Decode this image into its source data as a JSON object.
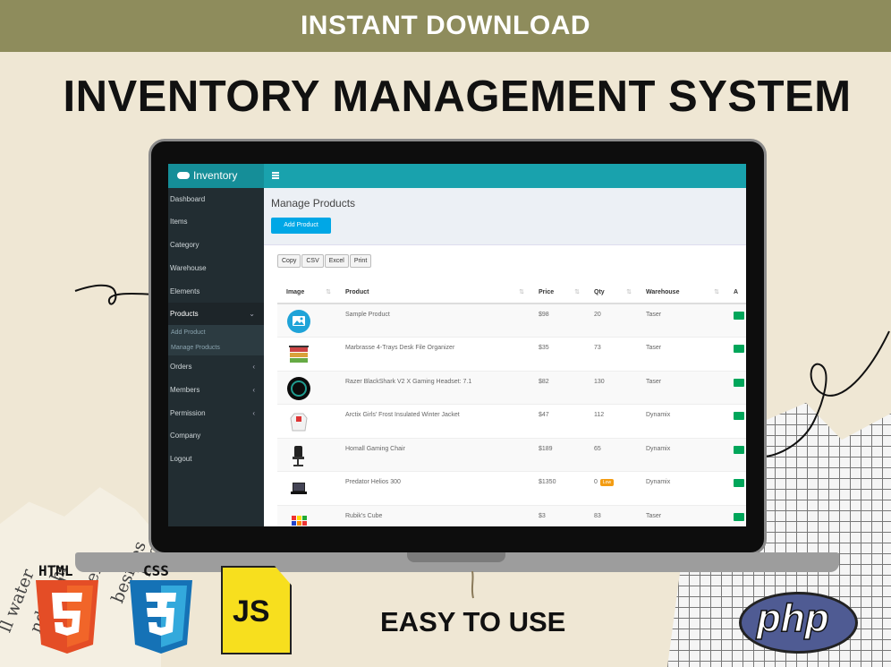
{
  "banner": {
    "text": "INSTANT DOWNLOAD"
  },
  "headline": {
    "text": "INVENTORY MANAGEMENT SYSTEM"
  },
  "app": {
    "brand": "Inventory",
    "sidebar": {
      "items": [
        {
          "label": "Dashboard"
        },
        {
          "label": "Items"
        },
        {
          "label": "Category"
        },
        {
          "label": "Warehouse"
        },
        {
          "label": "Elements"
        },
        {
          "label": "Products",
          "chevron": "⌄"
        },
        {
          "label": "Orders",
          "chevron": "‹"
        },
        {
          "label": "Members",
          "chevron": "‹"
        },
        {
          "label": "Permission",
          "chevron": "‹"
        },
        {
          "label": "Company"
        },
        {
          "label": "Logout"
        }
      ],
      "sub_items": [
        {
          "label": "Add Product"
        },
        {
          "label": "Manage Products"
        }
      ]
    },
    "page_title": "Manage Products",
    "add_button": "Add Product",
    "export_buttons": [
      "Copy",
      "CSV",
      "Excel",
      "Print"
    ],
    "table": {
      "columns": [
        "Image",
        "Product",
        "Price",
        "Qty",
        "Warehouse",
        "A"
      ],
      "rows": [
        {
          "product": "Sample Product",
          "price": "$98",
          "qty": "20",
          "warehouse": "Taser",
          "icon": "image-placeholder-icon"
        },
        {
          "product": "Marbrasse 4-Trays Desk File Organizer",
          "price": "$35",
          "qty": "73",
          "warehouse": "Taser",
          "icon": "file-organizer-icon"
        },
        {
          "product": "Razer BlackShark V2 X Gaming Headset: 7.1",
          "price": "$82",
          "qty": "130",
          "warehouse": "Taser",
          "icon": "headset-icon"
        },
        {
          "product": "Arctix Girls' Frost Insulated Winter Jacket",
          "price": "$47",
          "qty": "112",
          "warehouse": "Dynamix",
          "icon": "jacket-icon"
        },
        {
          "product": "Homall Gaming Chair",
          "price": "$189",
          "qty": "65",
          "warehouse": "Dynamix",
          "icon": "chair-icon"
        },
        {
          "product": "Predator Helios 300",
          "price": "$1350",
          "qty": "0",
          "warehouse": "Dynamix",
          "badge": "Low",
          "icon": "laptop-icon"
        },
        {
          "product": "Rubik's Cube",
          "price": "$3",
          "qty": "83",
          "warehouse": "Taser",
          "icon": "cube-icon"
        }
      ]
    }
  },
  "tech": {
    "html": "HTML",
    "css": "CSS",
    "js": "JS",
    "php": "php"
  },
  "tagline": "EASY TO USE",
  "colors": {
    "banner": "#8e8c5c",
    "background": "#efe7d4",
    "header": "#19a2ad",
    "sidebar": "#222d32",
    "accent": "#00a7e6"
  }
}
